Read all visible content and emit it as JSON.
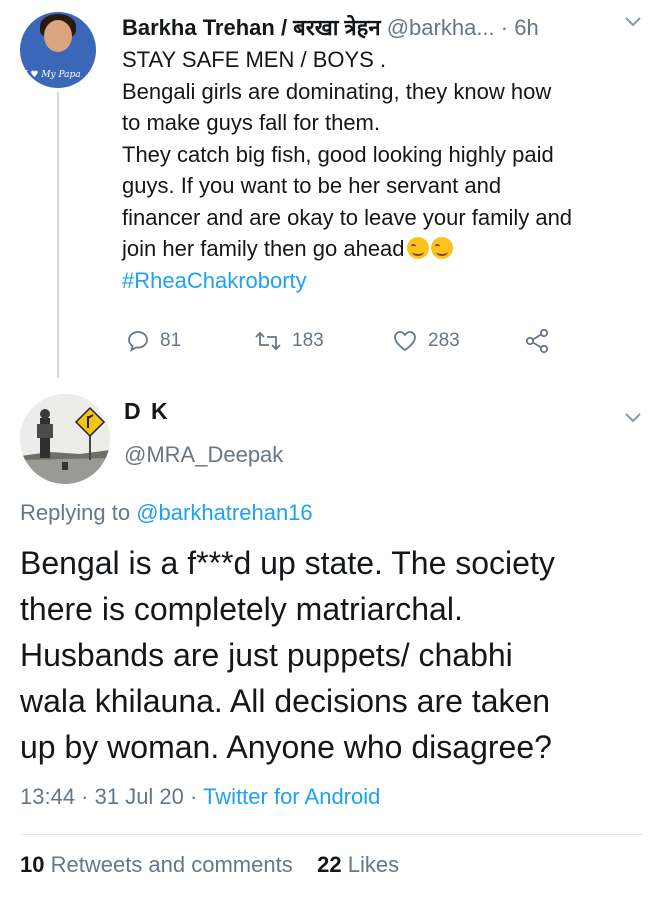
{
  "tweet1": {
    "author_name": "Barkha Trehan / बरखा त्रेहन",
    "author_handle": "@barkha...",
    "separator": "·",
    "time": "6h",
    "avatar_shirt_text": "I ♥ My Papa",
    "body_lines": [
      "STAY SAFE MEN / BOYS .",
      "Bengali girls are dominating, they know how",
      "to make guys fall for them.",
      "They catch big fish, good looking highly paid",
      "guys. If you want to be her servant and",
      "financer and are okay to leave your family and",
      "join her family then go ahead"
    ],
    "emoji": "smiling-face-with-smiling-eyes",
    "hashtag": "#RheaChakroborty",
    "actions": {
      "replies": "81",
      "retweets": "183",
      "likes": "283"
    }
  },
  "tweet2": {
    "author_name": "D K",
    "author_handle": "@MRA_Deepak",
    "replying_prefix": "Replying to",
    "replying_mention": "@barkhatrehan16",
    "body_lines": [
      "Bengal is a f***d up state. The society",
      "there is completely matriarchal.",
      "Husbands are just puppets/ chabhi",
      "wala khilauna. All decisions are taken",
      "up by woman. Anyone who disagree?"
    ],
    "timestamp": "13:44 · 31 Jul 20 ·",
    "source": "Twitter for Android",
    "stats": {
      "retweets_count": "10",
      "retweets_label": "Retweets and comments",
      "likes_count": "22",
      "likes_label": "Likes"
    }
  },
  "colors": {
    "link": "#1da1f2",
    "secondary_text": "#657786",
    "primary_text": "#14171a",
    "divider": "#e1e8ed"
  }
}
